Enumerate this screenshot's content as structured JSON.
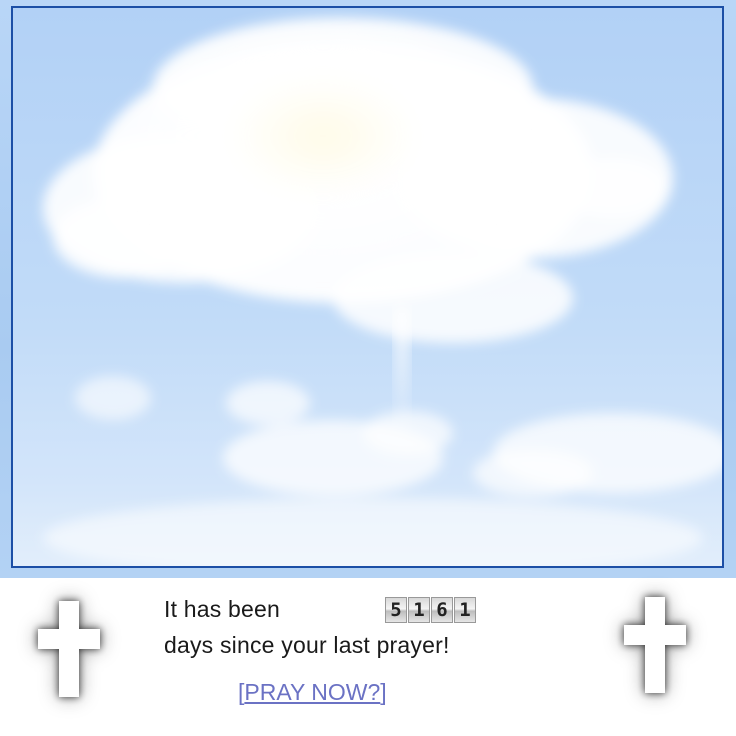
{
  "message": {
    "line1_prefix": "It has been",
    "counter_digits": [
      "5",
      "1",
      "6",
      "1"
    ],
    "line2": "days since your last prayer!"
  },
  "action": {
    "bracket_open": "[",
    "label": "PRAY NOW?",
    "bracket_close": "]"
  },
  "colors": {
    "frame_border": "#1c4fa6",
    "sky": "#b2d1f6",
    "link": "#6b72c4"
  },
  "icons": [
    "cross-icon",
    "cross-icon"
  ]
}
